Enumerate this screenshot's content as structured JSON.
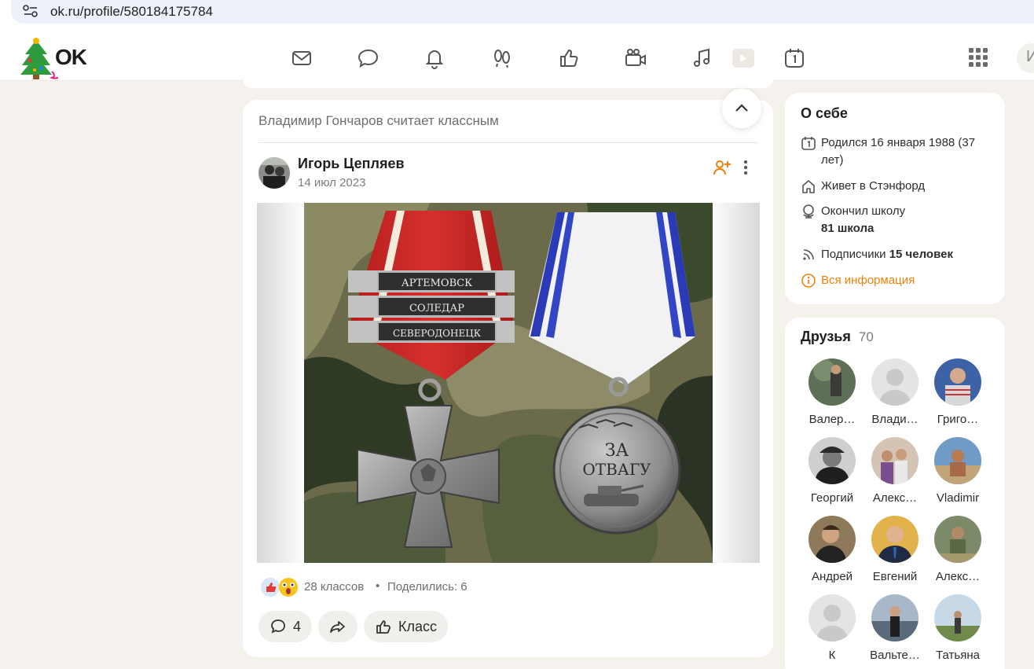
{
  "browser": {
    "url": "ok.ru/profile/580184175784"
  },
  "header": {
    "logo_text": "OK",
    "nav": [
      {
        "name": "messages-icon"
      },
      {
        "name": "discussions-icon"
      },
      {
        "name": "notifications-icon"
      },
      {
        "name": "guests-icon"
      },
      {
        "name": "likes-icon"
      },
      {
        "name": "video-icon"
      },
      {
        "name": "music-icon"
      },
      {
        "name": "play-icon"
      },
      {
        "name": "events-icon"
      }
    ],
    "search_placeholder": "И"
  },
  "post": {
    "liked_by": "Владимир Гончаров считает классным",
    "author": "Игорь Цепляев",
    "date": "14 июл 2023",
    "image_text": {
      "bar1": "АРТЕМОВСК",
      "bar2": "СОЛЕДАР",
      "bar3": "СЕВЕРОДОНЕЦК",
      "medal_line1": "ЗА",
      "medal_line2": "ОТВАГУ"
    },
    "likes_text": "28 классов",
    "separator": "•",
    "shares_text": "Поделились: 6",
    "comments_count": "4",
    "class_button": "Класс"
  },
  "about": {
    "title": "О себе",
    "born": "Родился 16 января 1988 (37 лет)",
    "lives": "Живет в Стэнфорд",
    "school_label": "Окончил школу",
    "school_name": "81 школа",
    "subscribers_label": "Подписчики",
    "subscribers_value": "15 человек",
    "all_info": "Вся информация"
  },
  "friends": {
    "title": "Друзья",
    "count": "70",
    "items": [
      {
        "name": "Валер…"
      },
      {
        "name": "Влади…"
      },
      {
        "name": "Григо…"
      },
      {
        "name": "Георгий"
      },
      {
        "name": "Алекс…"
      },
      {
        "name": "Vladimir"
      },
      {
        "name": "Андрей"
      },
      {
        "name": "Евгений"
      },
      {
        "name": "Алекс…"
      },
      {
        "name": "К"
      },
      {
        "name": "Вальте…"
      },
      {
        "name": "Татьяна"
      }
    ]
  },
  "colors": {
    "accent": "#ee8208",
    "page_bg": "#f5f1ec",
    "card_bg": "#ffffff"
  }
}
